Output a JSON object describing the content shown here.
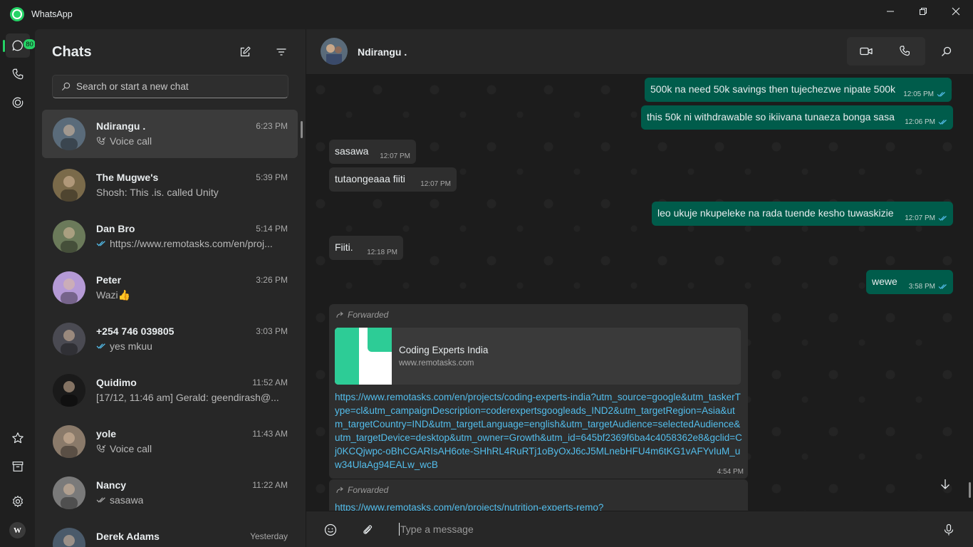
{
  "window": {
    "title": "WhatsApp"
  },
  "rail": {
    "unread_badge": "80",
    "profile_initials": "W"
  },
  "chatlist": {
    "heading": "Chats",
    "search_placeholder": "Search or start a new chat",
    "chats": [
      {
        "name": "Ndirangu .",
        "time": "6:23 PM",
        "preview": "Voice call",
        "preview_icon": "incoming-call-icon",
        "avatar_color": "#5a6b7a"
      },
      {
        "name": "The Mugwe's",
        "time": "5:39 PM",
        "preview": "Shosh: This .is. called  Unity",
        "preview_icon": "",
        "avatar_color": "#7a6a4a"
      },
      {
        "name": "Dan Bro",
        "time": "5:14 PM",
        "preview": "https://www.remotasks.com/en/proj...",
        "preview_icon": "double-tick-icon",
        "avatar_color": "#6b7a5a"
      },
      {
        "name": "Peter",
        "time": "3:26 PM",
        "preview": "Wazi👍",
        "preview_icon": "",
        "avatar_color": "#b59ad6"
      },
      {
        "name": "+254 746 039805",
        "time": "3:03 PM",
        "preview": "yes mkuu",
        "preview_icon": "double-tick-icon",
        "avatar_color": "#4a4a52"
      },
      {
        "name": "Quidimo",
        "time": "11:52 AM",
        "preview": "[17/12, 11:46 am] Gerald: geendirash@...",
        "preview_icon": "",
        "avatar_color": "#1a1a1a"
      },
      {
        "name": "yole",
        "time": "11:43 AM",
        "preview": "Voice call",
        "preview_icon": "incoming-call-icon",
        "avatar_color": "#8a7a6a"
      },
      {
        "name": "Nancy",
        "time": "11:22 AM",
        "preview": "sasawa",
        "preview_icon": "double-tick-grey-icon",
        "avatar_color": "#7a7a7a"
      },
      {
        "name": "Derek Adams",
        "time": "Yesterday",
        "preview": "",
        "preview_icon": "",
        "avatar_color": "#4a5a6a"
      }
    ]
  },
  "conversation": {
    "contact_name": "Ndirangu .",
    "messages": [
      {
        "dir": "out",
        "text": "500k na need 50k savings then tujechezwe nipate 500k",
        "time": "12:05 PM"
      },
      {
        "dir": "out",
        "text": "this 50k ni withdrawable so ikiivana tunaeza bonga sasa",
        "time": "12:06 PM"
      },
      {
        "dir": "in",
        "text": "sasawa",
        "time": "12:07 PM"
      },
      {
        "dir": "in",
        "text": "tutaongeaaa fiiti",
        "time": "12:07 PM"
      },
      {
        "dir": "out",
        "text": "leo ukuje nkupeleke na rada tuende kesho tuwaskizie",
        "time": "12:07 PM"
      },
      {
        "dir": "in",
        "text": "Fiiti.",
        "time": "12:18 PM"
      },
      {
        "dir": "out",
        "text": "wewe",
        "time": "3:58 PM"
      }
    ],
    "forwarded_label": "Forwarded",
    "link_card": {
      "title": "Coding Experts India",
      "domain": "www.remotasks.com"
    },
    "forwarded_link": "https://www.remotasks.com/en/projects/coding-experts-india?utm_source=google&utm_taskerType=cl&utm_campaignDescription=coderexpertsgoogleads_IND2&utm_targetRegion=Asia&utm_targetCountry=IND&utm_targetLanguage=english&utm_targetAudience=selectedAudience&utm_targetDevice=desktop&utm_owner=Growth&utm_id=645bf2369f6ba4c4058362e8&gclid=Cj0KCQjwpc-oBhCGARIsAH6ote-SHhRL4RuRTj1oByOxJ6cJ5MLnebHFU4m6tKG1vAFYvIuM_uw34UlaAg94EALw_wcB",
    "forwarded_time": "4:54 PM",
    "second_forwarded_link": "https://www.remotasks.com/en/projects/nutrition-experts-remo?",
    "composer_placeholder": "Type a message"
  },
  "colors": {
    "accent": "#25d366",
    "outgoing_bubble": "#005c4b",
    "incoming_bubble": "#2e2e2e",
    "link": "#53bdeb"
  }
}
